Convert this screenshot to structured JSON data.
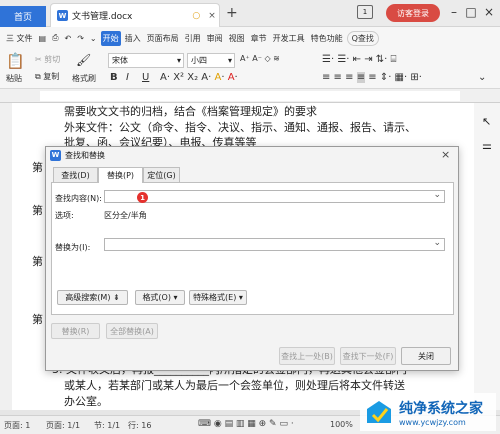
{
  "tabs": {
    "home": "首页",
    "doc": "文书管理.docx",
    "visitor": "访客登录"
  },
  "menu": {
    "file": "三 文件",
    "items": [
      "开始",
      "插入",
      "页面布局",
      "引用",
      "审阅",
      "视图",
      "章节",
      "开发工具",
      "特色功能"
    ],
    "active": "开始",
    "search": "Q查找"
  },
  "ribbon": {
    "paste": "粘贴",
    "cut": "剪切",
    "copy": "复制",
    "format_painter": "格式刷",
    "font_name": "宋体",
    "font_size": "小四",
    "bold": "B",
    "italic": "I",
    "underline": "U"
  },
  "document": {
    "line1": "需要收文文书的归档，结合《档案管理规定》的要求",
    "line2": "外来文件：公文（命令、指令、决议、指示、通知、通报、报告、请示、",
    "line3": "批复、函、会议纪要）、电报、传真等等",
    "side1": "第",
    "side2": "第",
    "side3": "第",
    "side4": "第",
    "line4": "3. 文件收文后，再报__________内所指定的会签部门，再送其他会签部门",
    "line5": "或某人，若某部门或某人为最后一个会签单位，则处理后将本文件转送",
    "line6": "办公室。"
  },
  "dialog": {
    "title": "查找和替换",
    "tab_find": "查找(D)",
    "tab_replace": "替换(P)",
    "tab_goto": "定位(G)",
    "find_label": "查找内容(N):",
    "find_value": "",
    "options_label": "选项:",
    "options_value": "区分全/半角",
    "replace_label": "替换为(I):",
    "replace_value": "",
    "badge": "1",
    "advanced_btn": "高级搜索(M)",
    "format_btn": "格式(O)",
    "special_btn": "特殊格式(E)",
    "replace_btn": "替换(R)",
    "replace_all_btn": "全部替换(A)",
    "find_prev_btn": "查找上一处(B)",
    "find_next_btn": "查找下一处(F)",
    "close_btn": "关闭"
  },
  "status": {
    "page": "页面: 1",
    "pages": "页面: 1/1",
    "section": "节: 1/1",
    "line": "行: 16",
    "zoom": "100%"
  },
  "watermark": {
    "title": "纯净系统之家",
    "url": "www.ycwjzy.com"
  }
}
